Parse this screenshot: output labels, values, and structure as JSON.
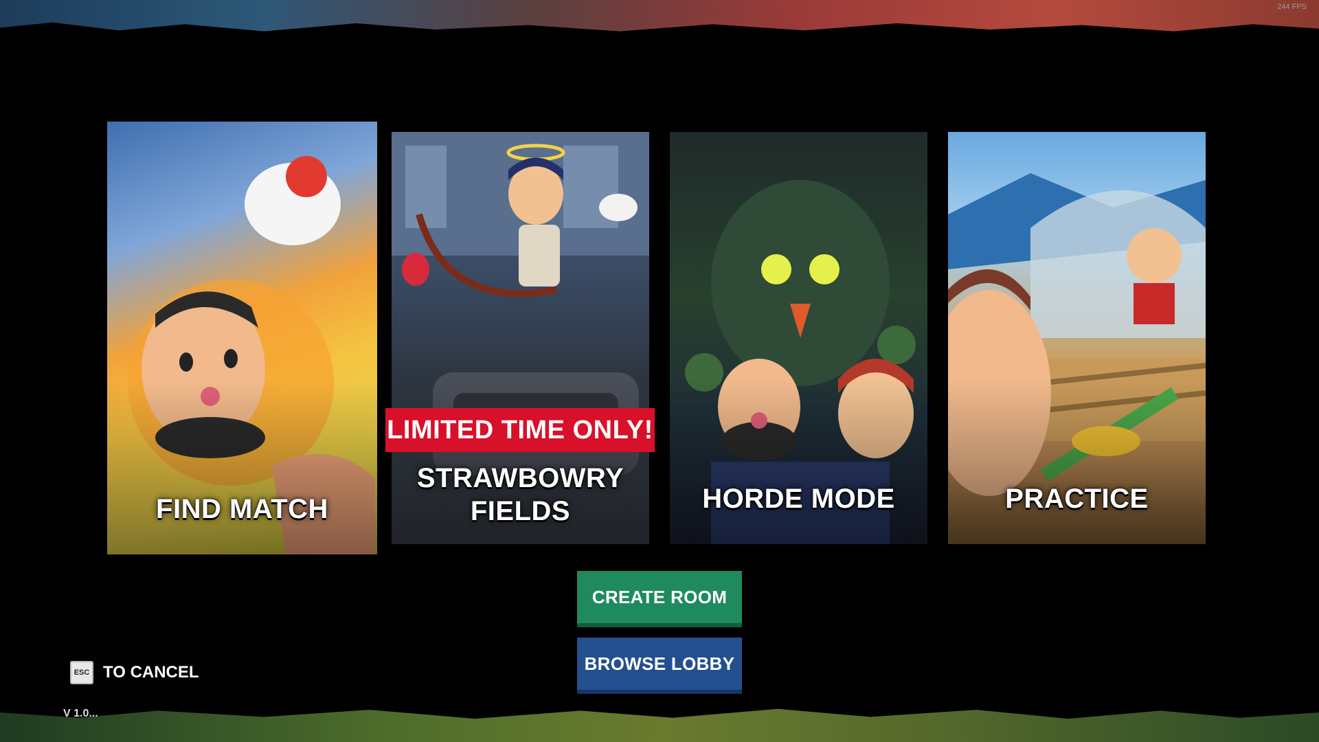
{
  "fps": "244 FPS",
  "cards": {
    "find_match": {
      "label": "FIND MATCH"
    },
    "strawbowry": {
      "label_line1": "STRAWBOWRY",
      "label_line2": "FIELDS",
      "banner": "LIMITED TIME ONLY!"
    },
    "horde": {
      "label": "HORDE MODE"
    },
    "practice": {
      "label": "PRACTICE"
    }
  },
  "buttons": {
    "create_room": "CREATE ROOM",
    "browse_lobby": "BROWSE LOBBY"
  },
  "cancel": {
    "key": "ESC",
    "label": "TO CANCEL"
  },
  "version": "V 1.0..."
}
